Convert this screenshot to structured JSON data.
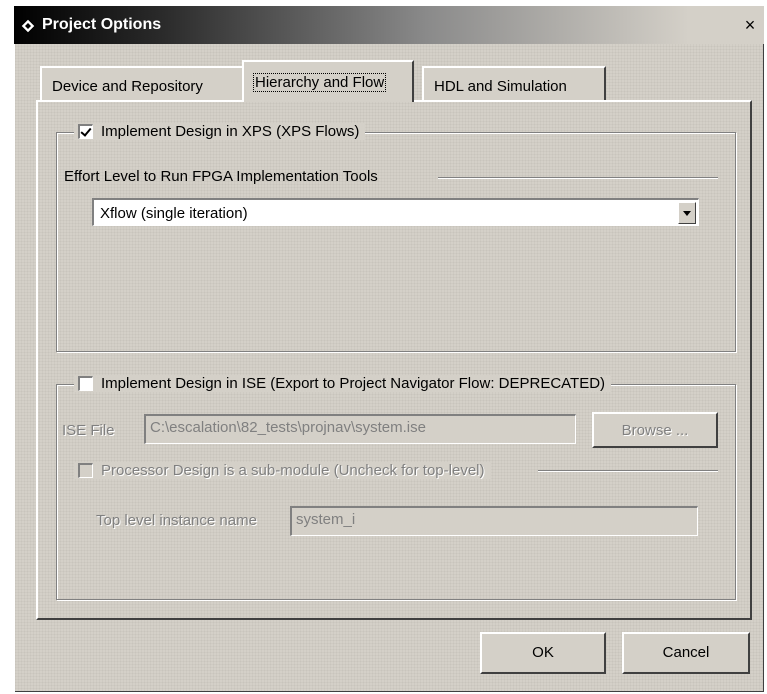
{
  "window": {
    "title": "Project Options",
    "close_glyph": "×"
  },
  "tabs": [
    {
      "label": "Device and Repository",
      "active": false
    },
    {
      "label": "Hierarchy and Flow",
      "active": true
    },
    {
      "label": "HDL and Simulation",
      "active": false
    }
  ],
  "xps_group": {
    "checkbox_label": "Implement Design in XPS (XPS Flows)",
    "checked": true,
    "effort_label": "Effort Level to Run FPGA Implementation Tools",
    "effort_value": "Xflow (single iteration)"
  },
  "ise_group": {
    "checkbox_label": "Implement Design in ISE (Export to Project Navigator Flow: DEPRECATED)",
    "checked": false,
    "ise_file_label": "ISE File",
    "ise_file_value": "C:\\escalation\\82_tests\\projnav\\system.ise",
    "browse_label": "Browse ...",
    "submodule_label": "Processor Design is a sub-module (Uncheck for top-level)",
    "submodule_checked": false,
    "top_level_label": "Top level instance name",
    "top_level_value": "system_i"
  },
  "footer": {
    "ok_label": "OK",
    "cancel_label": "Cancel"
  }
}
